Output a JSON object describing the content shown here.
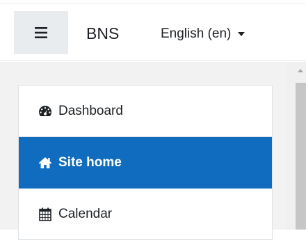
{
  "navbar": {
    "brand": "BNS",
    "language": "English (en)",
    "menu_icon": "hamburger-icon",
    "dropdown_icon": "caret-down-icon"
  },
  "nav": {
    "items": [
      {
        "label": "Dashboard",
        "icon": "tachometer-icon",
        "active": false
      },
      {
        "label": "Site home",
        "icon": "home-icon",
        "active": true
      },
      {
        "label": "Calendar",
        "icon": "calendar-icon",
        "active": false
      }
    ]
  },
  "colors": {
    "active_background": "#0f6cbf",
    "toggle_background": "#e9ecef",
    "text": "#1d2125",
    "drawer_background": "#f2f2f2"
  }
}
